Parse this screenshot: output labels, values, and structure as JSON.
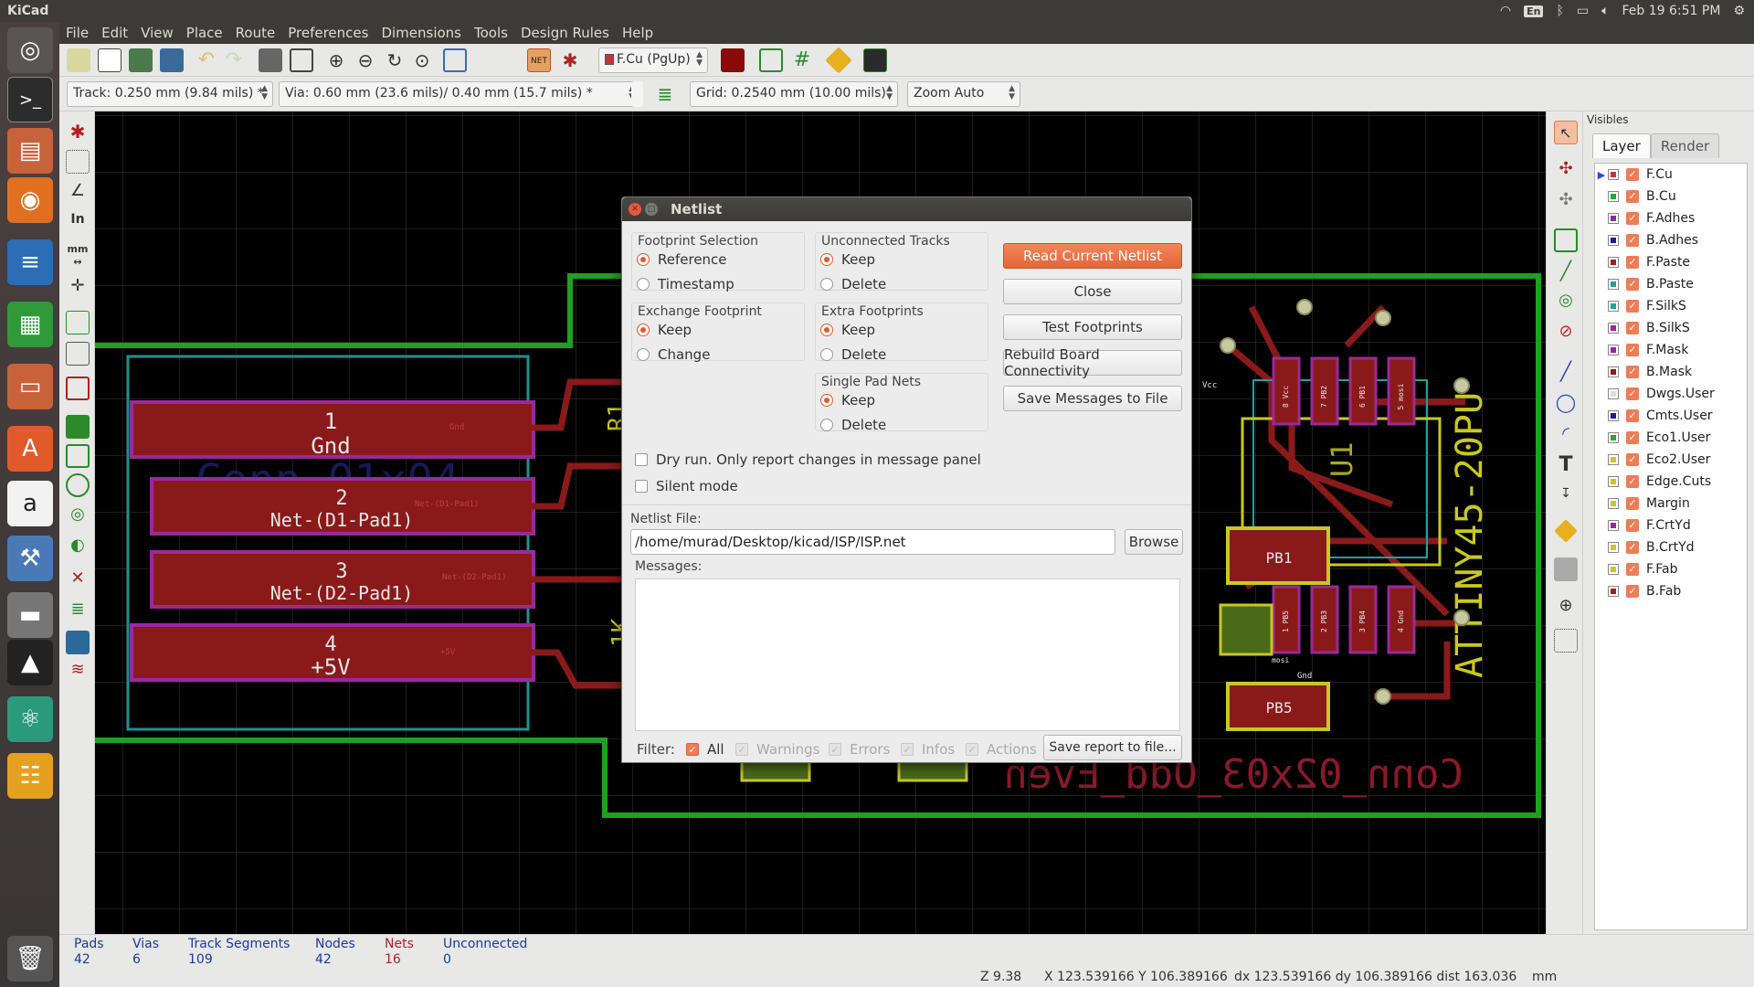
{
  "topbar": {
    "app_title": "KiCad",
    "lang": "En",
    "datetime": "Feb 19  6:51 PM"
  },
  "menu": [
    "File",
    "Edit",
    "View",
    "Place",
    "Route",
    "Preferences",
    "Dimensions",
    "Tools",
    "Design Rules",
    "Help"
  ],
  "toolbar": {
    "layer_select": "F.Cu (PgUp)",
    "track_select": "Track: 0.250 mm (9.84 mils) *",
    "via_select": "Via: 0.60 mm (23.6 mils)/ 0.40 mm (15.7 mils) *",
    "grid_select": "Grid: 0.2540 mm (10.00 mils)",
    "zoom_select": "Zoom Auto"
  },
  "board": {
    "connector": {
      "pads": [
        {
          "num": "1",
          "net": "Gnd"
        },
        {
          "num": "2",
          "net": "Net-(D1-Pad1)"
        },
        {
          "num": "3",
          "net": "Net-(D2-Pad1)"
        },
        {
          "num": "4",
          "net": "+5V"
        }
      ],
      "small_labels": [
        "Gnd",
        "Net-(D1-Pad1)",
        "Net-(D2-Pad1)",
        "+5V"
      ]
    },
    "ic_label": "ATTINY45-20PU",
    "ic_pin_labels_top": [
      "8 Vcc",
      "7 PB2",
      "6 PB1",
      "5 mosi"
    ],
    "ic_pin_labels_bottom": [
      "1 PB5",
      "2 PB3",
      "3 PB4",
      "4 Gnd"
    ],
    "isp_label": "Conn_02x03_Odd_Even",
    "pad_labels": [
      "PB1",
      "PB5"
    ],
    "misc_labels": [
      "Vcc",
      "Gnd",
      "U1",
      "mosi",
      "R1",
      "1K"
    ]
  },
  "dialog": {
    "title": "Netlist",
    "footprint_selection": {
      "label": "Footprint Selection",
      "options": [
        "Reference",
        "Timestamp"
      ],
      "selected": 0
    },
    "exchange_footprint": {
      "label": "Exchange Footprint",
      "options": [
        "Keep",
        "Change"
      ],
      "selected": 0
    },
    "unconnected_tracks": {
      "label": "Unconnected Tracks",
      "options": [
        "Keep",
        "Delete"
      ],
      "selected": 0
    },
    "extra_footprints": {
      "label": "Extra Footprints",
      "options": [
        "Keep",
        "Delete"
      ],
      "selected": 0
    },
    "single_pad_nets": {
      "label": "Single Pad Nets",
      "options": [
        "Keep",
        "Delete"
      ],
      "selected": 0
    },
    "buttons": {
      "read": "Read Current Netlist",
      "close": "Close",
      "test": "Test Footprints",
      "rebuild": "Rebuild Board Connectivity",
      "save_messages": "Save Messages to File"
    },
    "dry_run": "Dry run. Only report changes in message panel",
    "silent_mode": "Silent mode",
    "netlist_file_label": "Netlist File:",
    "netlist_file_value": "/home/murad/Desktop/kicad/ISP/ISP.net",
    "browse": "Browse",
    "messages_label": "Messages:",
    "filter": {
      "label": "Filter:",
      "all": "All",
      "warnings": "Warnings",
      "errors": "Errors",
      "infos": "Infos",
      "actions": "Actions",
      "save_report": "Save report to file..."
    }
  },
  "layers_panel": {
    "header": "Visibles",
    "tab_layer": "Layer",
    "tab_render": "Render",
    "layers": [
      {
        "name": "F.Cu",
        "color": "#c83434",
        "active": true
      },
      {
        "name": "B.Cu",
        "color": "#22aa22"
      },
      {
        "name": "F.Adhes",
        "color": "#8a2ba0"
      },
      {
        "name": "B.Adhes",
        "color": "#1a1a9a"
      },
      {
        "name": "F.Paste",
        "color": "#a02020"
      },
      {
        "name": "B.Paste",
        "color": "#20a0a0"
      },
      {
        "name": "F.SilkS",
        "color": "#20a0a0"
      },
      {
        "name": "B.SilkS",
        "color": "#a020a0"
      },
      {
        "name": "F.Mask",
        "color": "#a020a0"
      },
      {
        "name": "B.Mask",
        "color": "#8a1a1a"
      },
      {
        "name": "Dwgs.User",
        "color": "#dddddd"
      },
      {
        "name": "Cmts.User",
        "color": "#1a1aa0"
      },
      {
        "name": "Eco1.User",
        "color": "#22aa22"
      },
      {
        "name": "Eco2.User",
        "color": "#c8c820"
      },
      {
        "name": "Edge.Cuts",
        "color": "#c8c820"
      },
      {
        "name": "Margin",
        "color": "#c8c820"
      },
      {
        "name": "F.CrtYd",
        "color": "#a020a0"
      },
      {
        "name": "B.CrtYd",
        "color": "#c8c820"
      },
      {
        "name": "F.Fab",
        "color": "#c8c820"
      },
      {
        "name": "B.Fab",
        "color": "#a02020"
      }
    ]
  },
  "status": {
    "pads": {
      "label": "Pads",
      "value": "42"
    },
    "vias": {
      "label": "Vias",
      "value": "6"
    },
    "tracks": {
      "label": "Track Segments",
      "value": "109"
    },
    "nodes": {
      "label": "Nodes",
      "value": "42"
    },
    "nets": {
      "label": "Nets",
      "value": "16"
    },
    "unconnected": {
      "label": "Unconnected",
      "value": "0"
    },
    "zoom": "Z 9.38",
    "xy": "X 123.539166  Y 106.389166",
    "delta": "dx 123.539166  dy 106.389166  dist 163.036",
    "units": "mm"
  }
}
